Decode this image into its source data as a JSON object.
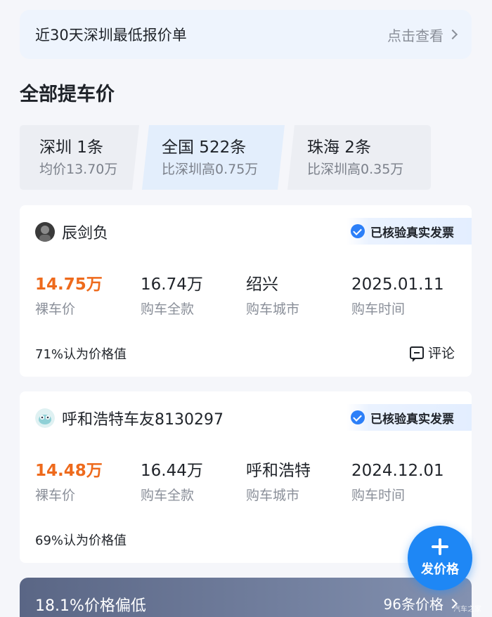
{
  "banner": {
    "title": "近30天深圳最低报价单",
    "link": "点击查看"
  },
  "section_title": "全部提车价",
  "tabs": [
    {
      "title": "深圳 1条",
      "sub": "均价13.70万",
      "selected": false
    },
    {
      "title": "全国 522条",
      "sub": "比深圳高0.75万",
      "selected": true
    },
    {
      "title": "珠海 2条",
      "sub": "比深圳高0.35万",
      "selected": false
    }
  ],
  "cards": [
    {
      "username": "辰剑负",
      "verify": "已核验真实发票",
      "stats": [
        {
          "value": "14.75万",
          "label": "裸车价"
        },
        {
          "value": "16.74万",
          "label": "购车全款"
        },
        {
          "value": "绍兴",
          "label": "购车城市"
        },
        {
          "value": "2025.01.11",
          "label": "购车时间"
        }
      ],
      "value_text": "71%认为价格值",
      "comment": "评论"
    },
    {
      "username": "呼和浩特车友8130297",
      "verify": "已核验真实发票",
      "stats": [
        {
          "value": "14.48万",
          "label": "裸车价"
        },
        {
          "value": "16.44万",
          "label": "购车全款"
        },
        {
          "value": "呼和浩特",
          "label": "购车城市"
        },
        {
          "value": "2024.12.01",
          "label": "购车时间"
        }
      ],
      "value_text": "69%认为价格值",
      "comment": "评论"
    }
  ],
  "bottom_bar": {
    "left": "18.1%价格偏低",
    "right": "96条价格"
  },
  "fab": {
    "label": "发价格"
  },
  "watermark": "汽车之家",
  "colors": {
    "accent": "#1e87f5",
    "price": "#ee6a1c",
    "verify": "#2c7ff8"
  }
}
